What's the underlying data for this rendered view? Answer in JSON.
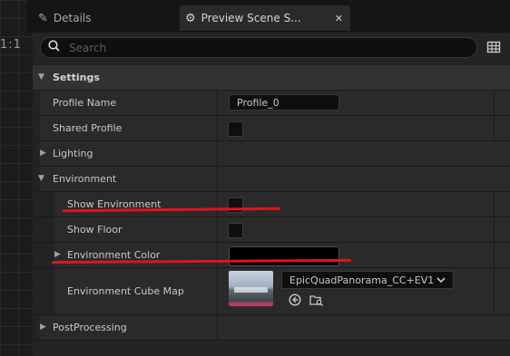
{
  "viewport": {
    "label": "1:1"
  },
  "tabs": [
    {
      "label": "Details",
      "icon": "pencil-icon",
      "active": false
    },
    {
      "label": "Preview Scene S...",
      "icon": "gear-icon",
      "active": true
    }
  ],
  "search": {
    "placeholder": "Search",
    "value": ""
  },
  "categories": {
    "settings": "Settings",
    "lighting": "Lighting",
    "environment": "Environment",
    "postprocessing": "PostProcessing"
  },
  "properties": {
    "profile_name": {
      "label": "Profile Name",
      "value": "Profile_0"
    },
    "shared_profile": {
      "label": "Shared Profile",
      "checked": false
    },
    "show_environment": {
      "label": "Show Environment",
      "checked": false
    },
    "show_floor": {
      "label": "Show Floor",
      "checked": false
    },
    "environment_color": {
      "label": "Environment Color",
      "color": "#000000"
    },
    "environment_cube_map": {
      "label": "Environment Cube Map",
      "asset": "EpicQuadPanorama_CC+EV1"
    }
  },
  "annotations": {
    "highlight_color": "#e0141e"
  },
  "colors": {
    "panel_bg": "#242424",
    "row_bg": "#2a2a2a",
    "category_bg": "#323232"
  }
}
